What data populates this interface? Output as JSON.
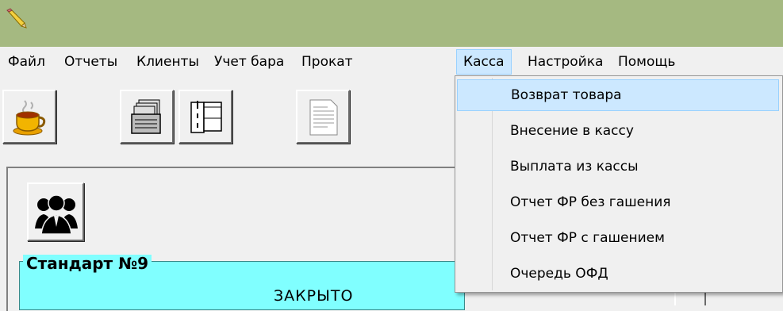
{
  "menubar": {
    "items": [
      {
        "label": "Файл"
      },
      {
        "label": "Отчеты"
      },
      {
        "label": "Клиенты"
      },
      {
        "label": "Учет бара"
      },
      {
        "label": "Прокат"
      },
      {
        "label": "Касса"
      },
      {
        "label": "Настройка"
      },
      {
        "label": "Помощь"
      }
    ],
    "active": "Касса"
  },
  "dropdown": {
    "items": [
      {
        "label": "Возврат товара"
      },
      {
        "label": "Внесение в кассу"
      },
      {
        "label": "Выплата из кассы"
      },
      {
        "label": "Отчет ФР без гашения"
      },
      {
        "label": "Отчет ФР с гашением"
      },
      {
        "label": "Очередь ОФД"
      }
    ],
    "highlighted": "Возврат товара"
  },
  "toolbar": {
    "buttons": [
      {
        "icon": "coffee-cup-icon"
      },
      {
        "icon": "card-file-icon"
      },
      {
        "icon": "binder-icon"
      },
      {
        "icon": "document-icon"
      }
    ]
  },
  "main": {
    "users_icon": "users-icon",
    "table": {
      "title": "Стандарт №9",
      "status": "ЗАКРЫТО"
    }
  },
  "colors": {
    "titlebar": "#a5b981",
    "menu_highlight": "#cce8ff",
    "table_bg": "#80ffff"
  }
}
